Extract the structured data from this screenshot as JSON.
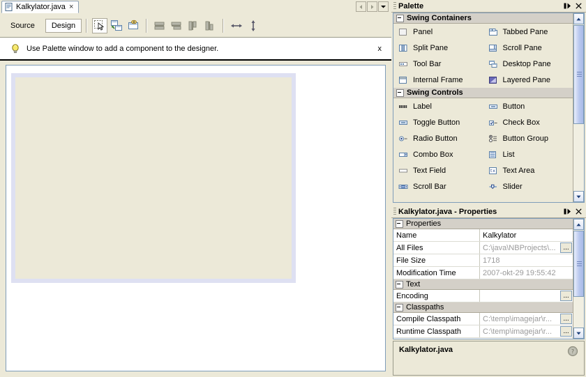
{
  "editor": {
    "tab": {
      "label": "Kalkylator.java",
      "close_label": "×",
      "icon": "java-file-icon"
    },
    "tab_nav": [
      {
        "name": "scroll-tabs-left-button",
        "icon": "triangle-left-icon"
      },
      {
        "name": "scroll-tabs-right-button",
        "icon": "triangle-right-icon"
      },
      {
        "name": "tab-list-dropdown-button",
        "icon": "triangle-down-icon"
      }
    ],
    "toolbar": {
      "source_label": "Source",
      "design_label": "Design",
      "active_view": "Design",
      "tools": [
        {
          "name": "selection-tool-icon",
          "pressed": true
        },
        {
          "name": "connection-mode-icon",
          "pressed": false
        },
        {
          "name": "preview-design-icon",
          "pressed": false
        }
      ],
      "align_tools": [
        {
          "name": "align-left-icon"
        },
        {
          "name": "align-right-icon"
        },
        {
          "name": "align-top-icon"
        },
        {
          "name": "align-bottom-icon"
        }
      ],
      "resize_tools": [
        {
          "name": "set-same-width-icon"
        },
        {
          "name": "set-same-height-icon"
        }
      ]
    },
    "notice": {
      "icon": "lightbulb-icon",
      "text": "Use Palette window to add a component to the designer.",
      "close_label": "x"
    }
  },
  "palette": {
    "title": "Palette",
    "buttons": [
      {
        "name": "minimize-window-button",
        "icon": "minimize-dock-icon"
      },
      {
        "name": "close-window-button",
        "icon": "close-icon"
      }
    ],
    "sections": [
      {
        "title": "Swing Containers",
        "items": [
          {
            "label": "Panel",
            "icon": "panel-icon"
          },
          {
            "label": "Tabbed Pane",
            "icon": "tabbed-pane-icon"
          },
          {
            "label": "Split Pane",
            "icon": "split-pane-icon"
          },
          {
            "label": "Scroll Pane",
            "icon": "scroll-pane-icon"
          },
          {
            "label": "Tool Bar",
            "icon": "tool-bar-icon"
          },
          {
            "label": "Desktop Pane",
            "icon": "desktop-pane-icon"
          },
          {
            "label": "Internal Frame",
            "icon": "internal-frame-icon"
          },
          {
            "label": "Layered Pane",
            "icon": "layered-pane-icon"
          }
        ]
      },
      {
        "title": "Swing Controls",
        "items": [
          {
            "label": "Label",
            "icon": "label-icon"
          },
          {
            "label": "Button",
            "icon": "button-icon"
          },
          {
            "label": "Toggle Button",
            "icon": "toggle-button-icon"
          },
          {
            "label": "Check Box",
            "icon": "check-box-icon"
          },
          {
            "label": "Radio Button",
            "icon": "radio-button-icon"
          },
          {
            "label": "Button Group",
            "icon": "button-group-icon"
          },
          {
            "label": "Combo Box",
            "icon": "combo-box-icon"
          },
          {
            "label": "List",
            "icon": "list-icon"
          },
          {
            "label": "Text Field",
            "icon": "text-field-icon"
          },
          {
            "label": "Text Area",
            "icon": "text-area-icon"
          },
          {
            "label": "Scroll Bar",
            "icon": "scroll-bar-icon"
          },
          {
            "label": "Slider",
            "icon": "slider-icon"
          }
        ]
      }
    ]
  },
  "properties": {
    "title": "Kalkylator.java - Properties",
    "buttons": [
      {
        "name": "minimize-window-button",
        "icon": "minimize-dock-icon"
      },
      {
        "name": "close-window-button",
        "icon": "close-icon"
      }
    ],
    "groups": [
      {
        "title": "Properties",
        "rows": [
          {
            "name": "Name",
            "value": "Kalkylator",
            "dim": false,
            "ellipsis": false
          },
          {
            "name": "All Files",
            "value": "C:\\java\\NBProjects\\...",
            "dim": true,
            "ellipsis": true
          },
          {
            "name": "File Size",
            "value": "1718",
            "dim": true,
            "ellipsis": false
          },
          {
            "name": "Modification Time",
            "value": "2007-okt-29 19:55:42",
            "dim": true,
            "ellipsis": false
          }
        ]
      },
      {
        "title": "Text",
        "rows": [
          {
            "name": "Encoding",
            "value": "",
            "dim": false,
            "ellipsis": true
          }
        ]
      },
      {
        "title": "Classpaths",
        "rows": [
          {
            "name": "Compile Classpath",
            "value": "C:\\temp\\imagejar\\r...",
            "dim": true,
            "ellipsis": true
          },
          {
            "name": "Runtime Classpath",
            "value": "C:\\temp\\imagejar\\r...",
            "dim": true,
            "ellipsis": true
          }
        ]
      }
    ],
    "footer": {
      "title": "Kalkylator.java",
      "help_icon": "help-question-icon"
    }
  },
  "colors": {
    "window_bg": "#ece9d8",
    "form_fill": "#ece9d8",
    "form_border": "#dee0f2",
    "canvas_bg": "#ffffff",
    "section_header": "#d4d0c8",
    "panel_border": "#7f9db9",
    "scrollbar_thumb": "#b9c8ee",
    "dim_text": "#9a9a9a"
  }
}
